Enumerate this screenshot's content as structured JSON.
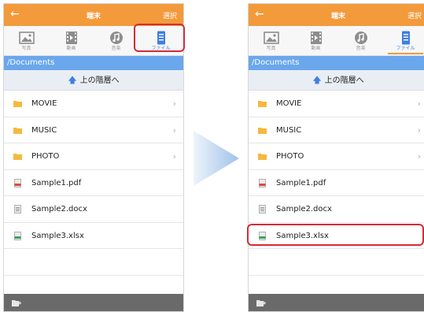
{
  "left": {
    "header": {
      "back_icon": "back-arrow-icon",
      "title": "端末",
      "select_label": "選択"
    },
    "tabs": [
      {
        "label": "写真",
        "icon": "photo-icon"
      },
      {
        "label": "動画",
        "icon": "film-icon"
      },
      {
        "label": "音楽",
        "icon": "music-icon"
      },
      {
        "label": "ファイル",
        "icon": "file-icon"
      }
    ],
    "active_tab": 3,
    "path": "/Documents",
    "up_label": "上の階層へ",
    "items": [
      {
        "label": "MOVIE",
        "type": "folder"
      },
      {
        "label": "MUSIC",
        "type": "folder"
      },
      {
        "label": "PHOTO",
        "type": "folder"
      },
      {
        "label": "Sample1.pdf",
        "type": "pdf"
      },
      {
        "label": "Sample2.docx",
        "type": "doc"
      },
      {
        "label": "Sample3.xlsx",
        "type": "xls"
      }
    ]
  },
  "right": {
    "header": {
      "back_icon": "back-arrow-icon",
      "title": "端末",
      "select_label": "選択"
    },
    "tabs": [
      {
        "label": "写真",
        "icon": "photo-icon"
      },
      {
        "label": "動画",
        "icon": "film-icon"
      },
      {
        "label": "音楽",
        "icon": "music-icon"
      },
      {
        "label": "ファイル",
        "icon": "file-icon"
      }
    ],
    "active_tab": 3,
    "path": "/Documents",
    "up_label": "上の階層へ",
    "items": [
      {
        "label": "MOVIE",
        "type": "folder"
      },
      {
        "label": "MUSIC",
        "type": "folder"
      },
      {
        "label": "PHOTO",
        "type": "folder"
      },
      {
        "label": "Sample1.pdf",
        "type": "pdf"
      },
      {
        "label": "Sample2.docx",
        "type": "doc"
      },
      {
        "label": "Sample3.xlsx",
        "type": "xls"
      }
    ]
  },
  "colors": {
    "header": "#f39a3b",
    "path_bar": "#6aa7ec",
    "folder": "#f5b93e",
    "highlight": "#d62a38",
    "active_tab": "#3f7fe0",
    "bottom_bar": "#6a6a6a"
  }
}
